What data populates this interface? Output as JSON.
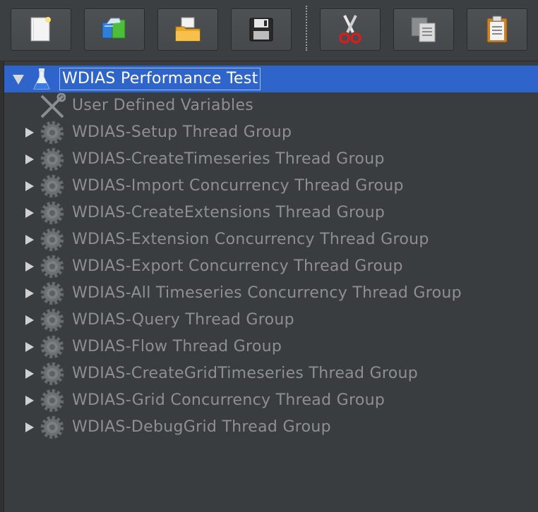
{
  "toolbar": {
    "buttons": [
      {
        "name": "new",
        "icon": "new-document-icon"
      },
      {
        "name": "templates",
        "icon": "templates-icon"
      },
      {
        "name": "open",
        "icon": "open-folder-icon"
      },
      {
        "name": "save",
        "icon": "save-disk-icon"
      },
      {
        "name": "cut",
        "icon": "scissors-icon"
      },
      {
        "name": "copy",
        "icon": "copy-icon"
      },
      {
        "name": "paste",
        "icon": "clipboard-icon"
      }
    ]
  },
  "tree": {
    "root": {
      "label": "WDIAS Performance Test",
      "icon": "test-plan-flask-icon",
      "expanded": true,
      "selected": true
    },
    "children": [
      {
        "label": "User Defined Variables",
        "icon": "config-wrench-icon",
        "expandable": false
      },
      {
        "label": "WDIAS-Setup Thread Group",
        "icon": "thread-group-gear-icon",
        "expandable": true
      },
      {
        "label": "WDIAS-CreateTimeseries Thread Group",
        "icon": "thread-group-gear-icon",
        "expandable": true
      },
      {
        "label": "WDIAS-Import Concurrency Thread Group",
        "icon": "thread-group-gear-icon",
        "expandable": true
      },
      {
        "label": "WDIAS-CreateExtensions Thread Group",
        "icon": "thread-group-gear-icon",
        "expandable": true
      },
      {
        "label": "WDIAS-Extension Concurrency Thread Group",
        "icon": "thread-group-gear-icon",
        "expandable": true
      },
      {
        "label": "WDIAS-Export Concurrency Thread Group",
        "icon": "thread-group-gear-icon",
        "expandable": true
      },
      {
        "label": "WDIAS-All Timeseries Concurrency Thread Group",
        "icon": "thread-group-gear-icon",
        "expandable": true
      },
      {
        "label": "WDIAS-Query Thread Group",
        "icon": "thread-group-gear-icon",
        "expandable": true
      },
      {
        "label": "WDIAS-Flow Thread Group",
        "icon": "thread-group-gear-icon",
        "expandable": true
      },
      {
        "label": "WDIAS-CreateGridTimeseries Thread Group",
        "icon": "thread-group-gear-icon",
        "expandable": true
      },
      {
        "label": "WDIAS-Grid Concurrency Thread Group",
        "icon": "thread-group-gear-icon",
        "expandable": true
      },
      {
        "label": "WDIAS-DebugGrid Thread Group",
        "icon": "thread-group-gear-icon",
        "expandable": true
      }
    ]
  },
  "colors": {
    "background": "#3c3f41",
    "selection": "#2f65ca",
    "disabled_text": "#8d8f91",
    "selected_text": "#ffffff"
  }
}
